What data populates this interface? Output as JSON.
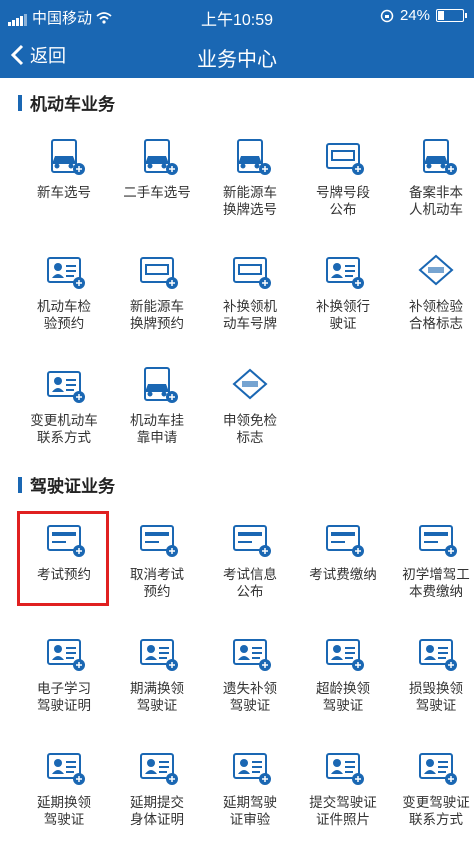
{
  "status": {
    "carrier": "中国移动",
    "time": "上午10:59",
    "battery": "24%",
    "battery_level": 0.24
  },
  "nav": {
    "back_label": "返回",
    "title": "业务中心"
  },
  "sections": [
    {
      "title": "机动车业务",
      "items": [
        {
          "label": "新车选号",
          "icon": "new-car-icon"
        },
        {
          "label": "二手车选号",
          "icon": "used-car-icon"
        },
        {
          "label": "新能源车\n换牌选号",
          "icon": "ev-car-icon"
        },
        {
          "label": "号牌号段\n公布",
          "icon": "plate-range-icon"
        },
        {
          "label": "备案非本\n人机动车",
          "icon": "record-vehicle-icon"
        },
        {
          "label": "机动车检\n验预约",
          "icon": "inspection-icon"
        },
        {
          "label": "新能源车\n换牌预约",
          "icon": "ev-plate-icon"
        },
        {
          "label": "补换领机\n动车号牌",
          "icon": "replace-plate-icon"
        },
        {
          "label": "补换领行\n驶证",
          "icon": "replace-license-icon"
        },
        {
          "label": "补领检验\n合格标志",
          "icon": "inspection-badge-icon"
        },
        {
          "label": "变更机动车\n联系方式",
          "icon": "change-contact-icon"
        },
        {
          "label": "机动车挂\n靠申请",
          "icon": "affiliation-icon"
        },
        {
          "label": "申领免检\n标志",
          "icon": "exempt-badge-icon"
        }
      ]
    },
    {
      "title": "驾驶证业务",
      "items": [
        {
          "label": "考试预约",
          "icon": "exam-booking-icon"
        },
        {
          "label": "取消考试\n预约",
          "icon": "cancel-exam-icon"
        },
        {
          "label": "考试信息\n公布",
          "icon": "exam-info-icon"
        },
        {
          "label": "考试费缴纳",
          "icon": "exam-fee-icon"
        },
        {
          "label": "初学增驾工\n本费缴纳",
          "icon": "learner-fee-icon"
        },
        {
          "label": "电子学习\n驾驶证明",
          "icon": "e-learning-cert-icon"
        },
        {
          "label": "期满换领\n驾驶证",
          "icon": "expiry-renew-icon"
        },
        {
          "label": "遗失补领\n驾驶证",
          "icon": "lost-replace-icon"
        },
        {
          "label": "超龄换领\n驾驶证",
          "icon": "overage-renew-icon"
        },
        {
          "label": "损毁换领\n驾驶证",
          "icon": "damaged-renew-icon"
        },
        {
          "label": "延期换领\n驾驶证",
          "icon": "deferred-renew-icon"
        },
        {
          "label": "延期提交\n身体证明",
          "icon": "health-proof-icon"
        },
        {
          "label": "延期驾驶\n证审验",
          "icon": "deferred-review-icon"
        },
        {
          "label": "提交驾驶证\n证件照片",
          "icon": "submit-photo-icon"
        },
        {
          "label": "变更驾驶证\n联系方式",
          "icon": "license-contact-icon"
        }
      ]
    }
  ]
}
